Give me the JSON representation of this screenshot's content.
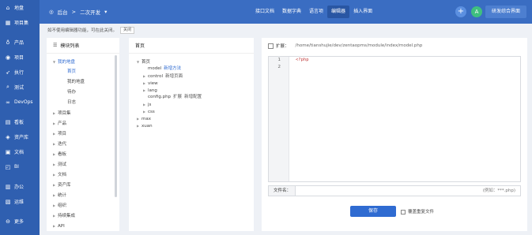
{
  "sidebar": {
    "items": [
      {
        "icon": "home-icon",
        "glyph": "⌂",
        "label": "地盘"
      },
      {
        "icon": "project-set-icon",
        "glyph": "▦",
        "label": "项目集"
      },
      {
        "icon": "product-icon",
        "glyph": "♁",
        "label": "产品"
      },
      {
        "icon": "project-icon",
        "glyph": "◉",
        "label": "项目"
      },
      {
        "icon": "execution-icon",
        "glyph": "➶",
        "label": "执行"
      },
      {
        "icon": "test-icon",
        "glyph": "⌕",
        "label": "测试"
      },
      {
        "icon": "devops-icon",
        "glyph": "∞",
        "label": "DevOps"
      },
      {
        "icon": "kanban-icon",
        "glyph": "▤",
        "label": "看板"
      },
      {
        "icon": "asset-lib-icon",
        "glyph": "◈",
        "label": "资产库"
      },
      {
        "icon": "doc-icon",
        "glyph": "▣",
        "label": "文档"
      },
      {
        "icon": "bi-icon",
        "glyph": "◰",
        "label": "BI"
      },
      {
        "icon": "office-icon",
        "glyph": "▥",
        "label": "办公"
      },
      {
        "icon": "ops-icon",
        "glyph": "▧",
        "label": "运维"
      },
      {
        "icon": "more-icon",
        "glyph": "⊖",
        "label": "更多"
      }
    ]
  },
  "topbar": {
    "crumb_back": "后台",
    "crumb_sep": ">",
    "crumb_current": "二次开发",
    "nav": [
      {
        "label": "接口文档",
        "active": false
      },
      {
        "label": "数据字典",
        "active": false
      },
      {
        "label": "语言项",
        "active": false
      },
      {
        "label": "编辑器",
        "active": true
      },
      {
        "label": "插入界面",
        "active": false
      }
    ],
    "plus": "+",
    "avatar": "A",
    "dev_button": "研发综合界面"
  },
  "notice": {
    "text": "如不使用编辑器功能，可在此关闭。",
    "close": "关闭"
  },
  "module_panel": {
    "title": "模块列表",
    "items": [
      {
        "label": "我的地盘",
        "level": 0,
        "caret": "▼",
        "blue": true
      },
      {
        "label": "首页",
        "level": 1,
        "caret": "",
        "blue": true
      },
      {
        "label": "我的地盘",
        "level": 1,
        "caret": "",
        "blue": false
      },
      {
        "label": "待办",
        "level": 1,
        "caret": "",
        "blue": false
      },
      {
        "label": "日志",
        "level": 1,
        "caret": "",
        "blue": false
      },
      {
        "label": "项目集",
        "level": 0,
        "caret": "▶",
        "blue": false
      },
      {
        "label": "产品",
        "level": 0,
        "caret": "▶",
        "blue": false
      },
      {
        "label": "项目",
        "level": 0,
        "caret": "▶",
        "blue": false
      },
      {
        "label": "迭代",
        "level": 0,
        "caret": "▶",
        "blue": false
      },
      {
        "label": "看板",
        "level": 0,
        "caret": "▶",
        "blue": false
      },
      {
        "label": "测试",
        "level": 0,
        "caret": "▶",
        "blue": false
      },
      {
        "label": "文档",
        "level": 0,
        "caret": "▶",
        "blue": false
      },
      {
        "label": "资产库",
        "level": 0,
        "caret": "▶",
        "blue": false
      },
      {
        "label": "统计",
        "level": 0,
        "caret": "▶",
        "blue": false
      },
      {
        "label": "组织",
        "level": 0,
        "caret": "▶",
        "blue": false
      },
      {
        "label": "持续集成",
        "level": 0,
        "caret": "▶",
        "blue": false
      },
      {
        "label": "API",
        "level": 0,
        "caret": "▶",
        "blue": false
      }
    ]
  },
  "file_panel": {
    "title": "首页",
    "tree": [
      {
        "label": "首页",
        "level": 0,
        "caret": "▼",
        "actions": []
      },
      {
        "label": "model",
        "level": 1,
        "caret": "",
        "actions": [
          {
            "label": "新增方法",
            "style": "blue"
          }
        ]
      },
      {
        "label": "control",
        "level": 1,
        "caret": "▶",
        "actions": [
          {
            "label": "新增页面",
            "style": "gray"
          }
        ]
      },
      {
        "label": "view",
        "level": 1,
        "caret": "▶",
        "actions": []
      },
      {
        "label": "lang",
        "level": 1,
        "caret": "▶",
        "actions": []
      },
      {
        "label": "config.php",
        "level": 1,
        "caret": "",
        "actions": [
          {
            "label": "扩展",
            "style": "gray"
          },
          {
            "label": "新增配置",
            "style": "gray"
          }
        ]
      },
      {
        "label": "js",
        "level": 1,
        "caret": "▶",
        "actions": []
      },
      {
        "label": "css",
        "level": 1,
        "caret": "▶",
        "actions": []
      },
      {
        "label": "max",
        "level": 0,
        "caret": "▶",
        "actions": []
      },
      {
        "label": "xuan",
        "level": 0,
        "caret": "▶",
        "actions": []
      }
    ]
  },
  "editor_panel": {
    "ext_label": "扩展：",
    "path": "/home/tianshujie/dev/zentaopms/module/index/model.php",
    "lines": [
      {
        "num": "1",
        "code": "<?php"
      },
      {
        "num": "2",
        "code": ""
      }
    ],
    "filename_label": "文件名：",
    "filename_value": "",
    "filename_hint": "(例如：***.php)",
    "save": "保存",
    "overwrite": "覆盖重复文件"
  }
}
